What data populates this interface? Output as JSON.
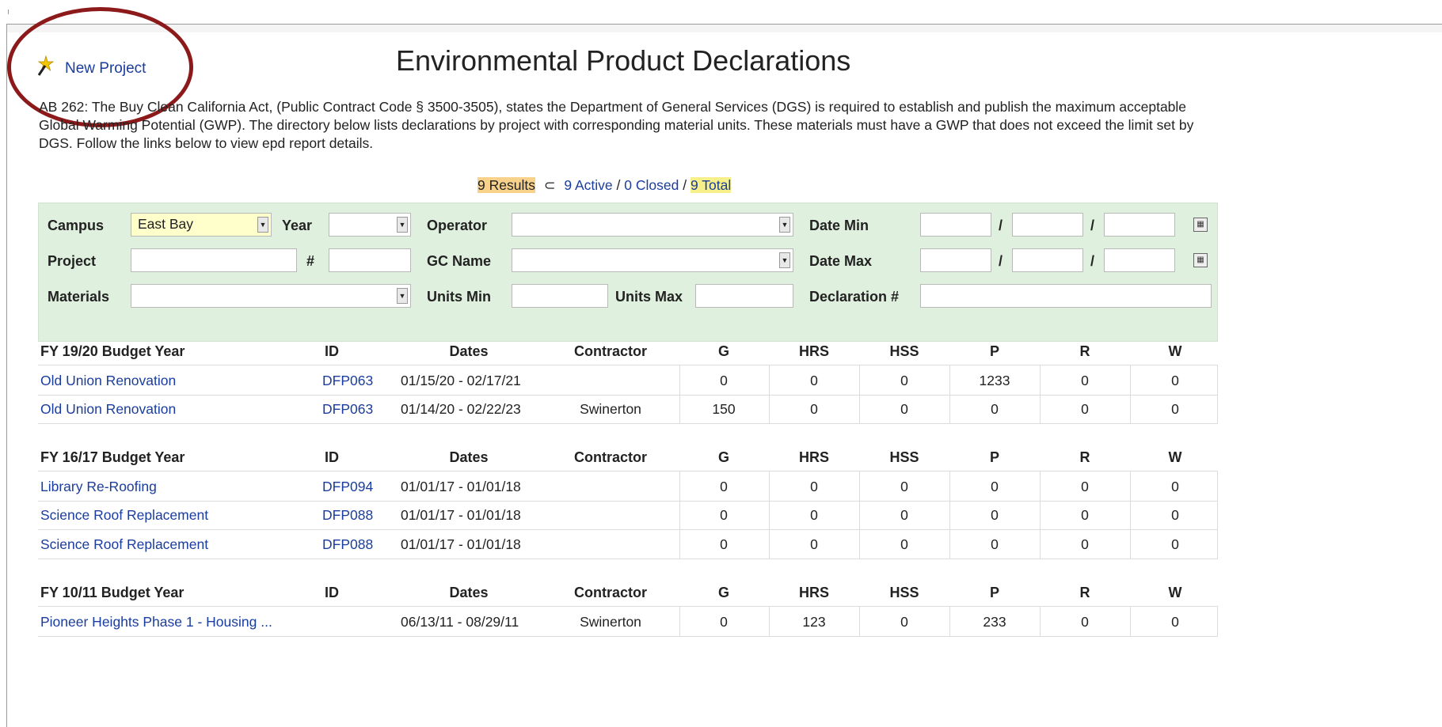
{
  "header": {
    "new_project_label": "New Project",
    "title": "Environmental Product Declarations",
    "description": "AB 262: The Buy Clean California Act, (Public Contract Code § 3500-3505), states the Department of General Services (DGS) is required to establish and publish the maximum acceptable Global Warming Potential (GWP). The directory below lists declarations by project with corresponding material units. These materials must have a GWP that does not exceed the limit set by DGS. Follow the links below to view epd report details."
  },
  "summary": {
    "results": "9 Results",
    "subset_symbol": "⊂",
    "active": "9 Active",
    "sep1": "/",
    "closed": "0 Closed",
    "sep2": "/",
    "total": "9 Total"
  },
  "filters": {
    "campus_label": "Campus",
    "campus_value": "East Bay",
    "year_label": "Year",
    "operator_label": "Operator",
    "date_min_label": "Date Min",
    "project_label": "Project",
    "number_label": "#",
    "gc_name_label": "GC Name",
    "date_max_label": "Date Max",
    "materials_label": "Materials",
    "units_min_label": "Units Min",
    "units_max_label": "Units Max",
    "declaration_label": "Declaration #",
    "date_separator": "/"
  },
  "columns": [
    "ID",
    "Dates",
    "Contractor",
    "G",
    "HRS",
    "HSS",
    "P",
    "R",
    "W"
  ],
  "groups": [
    {
      "heading": "FY 19/20  Budget Year",
      "rows": [
        {
          "project": "Old Union Renovation",
          "id": "DFP063",
          "dates": "01/15/20 - 02/17/21",
          "contractor": "",
          "g": "0",
          "hrs": "0",
          "hss": "0",
          "p": "1233",
          "r": "0",
          "w": "0"
        },
        {
          "project": "Old Union Renovation",
          "id": "DFP063",
          "dates": "01/14/20 - 02/22/23",
          "contractor": "Swinerton",
          "g": "150",
          "hrs": "0",
          "hss": "0",
          "p": "0",
          "r": "0",
          "w": "0"
        }
      ]
    },
    {
      "heading": "FY 16/17  Budget Year",
      "rows": [
        {
          "project": "Library Re-Roofing",
          "id": "DFP094",
          "dates": "01/01/17 - 01/01/18",
          "contractor": "",
          "g": "0",
          "hrs": "0",
          "hss": "0",
          "p": "0",
          "r": "0",
          "w": "0"
        },
        {
          "project": "Science Roof Replacement",
          "id": "DFP088",
          "dates": "01/01/17 - 01/01/18",
          "contractor": "",
          "g": "0",
          "hrs": "0",
          "hss": "0",
          "p": "0",
          "r": "0",
          "w": "0"
        },
        {
          "project": "Science Roof Replacement",
          "id": "DFP088",
          "dates": "01/01/17 - 01/01/18",
          "contractor": "",
          "g": "0",
          "hrs": "0",
          "hss": "0",
          "p": "0",
          "r": "0",
          "w": "0"
        }
      ]
    },
    {
      "heading": "FY 10/11  Budget Year",
      "rows": [
        {
          "project": "Pioneer Heights Phase 1 - Housing ...",
          "id": "",
          "dates": "06/13/11 - 08/29/11",
          "contractor": "Swinerton",
          "g": "0",
          "hrs": "123",
          "hss": "0",
          "p": "233",
          "r": "0",
          "w": "0"
        }
      ]
    }
  ],
  "colors": {
    "link": "#1a3d9e",
    "filter_bg": "#dff0de",
    "annotation_ring": "#8d1a1a",
    "results_highlight": "#f8d18a",
    "total_highlight": "#f6ef8a",
    "campus_select_bg": "#ffffcc"
  }
}
